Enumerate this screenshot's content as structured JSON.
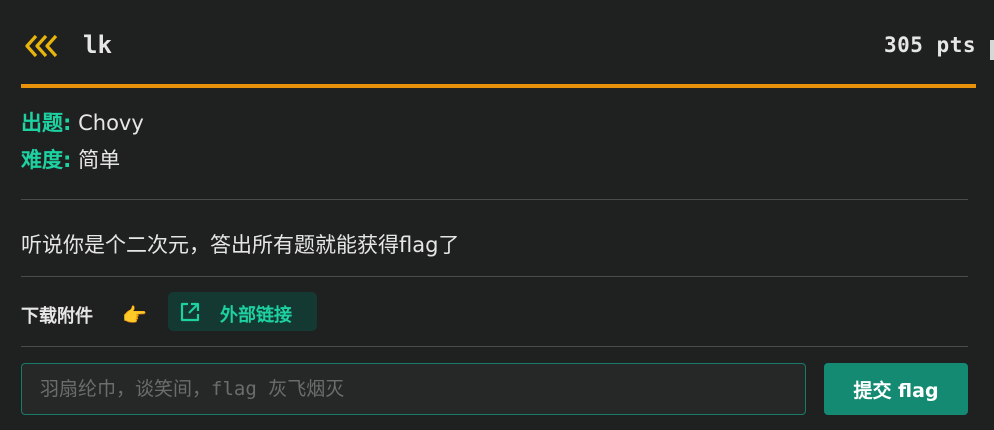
{
  "challenge": {
    "title": "lk",
    "points": "305 pts"
  },
  "meta": {
    "author_label": "出题:",
    "author": "Chovy",
    "difficulty_label": "难度:",
    "difficulty": "简单"
  },
  "description": "听说你是个二次元，答出所有题就能获得flag了",
  "attachment": {
    "label": "下载附件",
    "hand_emoji": "👉",
    "link_label": "外部链接"
  },
  "submit": {
    "placeholder": "羽扇纶巾，谈笑间，flag 灰飞烟灭",
    "button_label": "提交 flag"
  },
  "colors": {
    "accent_orange": "#e8920c",
    "accent_teal": "#1dd1a1",
    "button_teal": "#148a72",
    "background": "#1f2020"
  },
  "icons": {
    "back": "triple-chevron-left-icon",
    "external_link": "external-link-icon"
  }
}
